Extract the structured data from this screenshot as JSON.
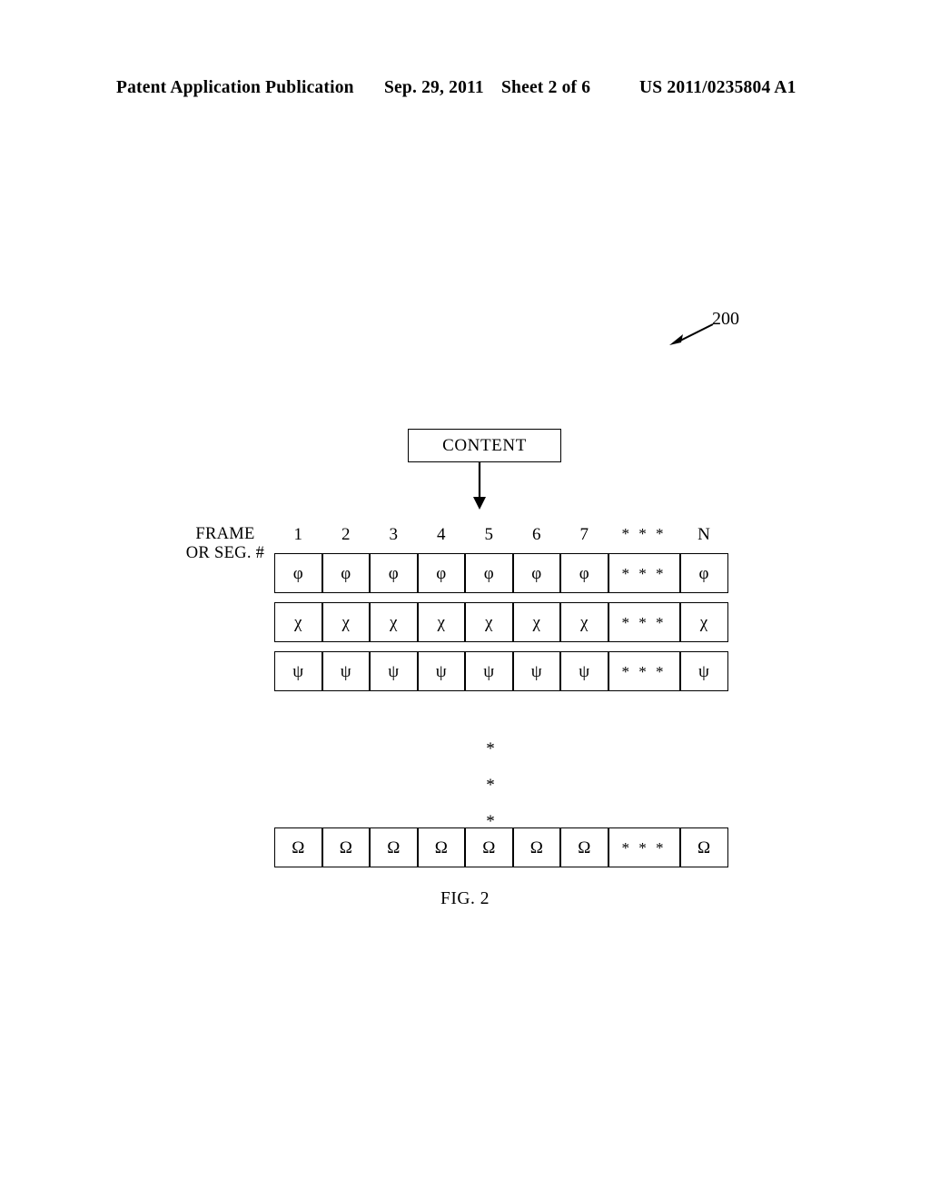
{
  "header": {
    "publication": "Patent Application Publication",
    "date": "Sep. 29, 2011",
    "sheet": "Sheet 2 of 6",
    "doc_number": "US 2011/0235804 A1"
  },
  "figure": {
    "reference_numeral": "200",
    "caption": "FIG. 2",
    "content_box_label": "CONTENT",
    "row_axis_label_line1": "FRAME",
    "row_axis_label_line2": "OR SEG. #",
    "column_headers": [
      "1",
      "2",
      "3",
      "4",
      "5",
      "6",
      "7",
      "* * *",
      "N"
    ],
    "ellipsis_marker": "* * *",
    "vertical_ellipsis": [
      "*",
      "*",
      "*"
    ],
    "rows": [
      {
        "symbol": "φ",
        "symbol_name": "phi",
        "cells": [
          "φ",
          "φ",
          "φ",
          "φ",
          "φ",
          "φ",
          "φ",
          "* * *",
          "φ"
        ]
      },
      {
        "symbol": "χ",
        "symbol_name": "chi",
        "cells": [
          "χ",
          "χ",
          "χ",
          "χ",
          "χ",
          "χ",
          "χ",
          "* * *",
          "χ"
        ]
      },
      {
        "symbol": "ψ",
        "symbol_name": "psi",
        "cells": [
          "ψ",
          "ψ",
          "ψ",
          "ψ",
          "ψ",
          "ψ",
          "ψ",
          "* * *",
          "ψ"
        ]
      },
      {
        "symbol": "Ω",
        "symbol_name": "omega",
        "cells": [
          "Ω",
          "Ω",
          "Ω",
          "Ω",
          "Ω",
          "Ω",
          "Ω",
          "* * *",
          "Ω"
        ]
      }
    ],
    "colors": {
      "ink": "#000000",
      "page": "#ffffff"
    }
  }
}
